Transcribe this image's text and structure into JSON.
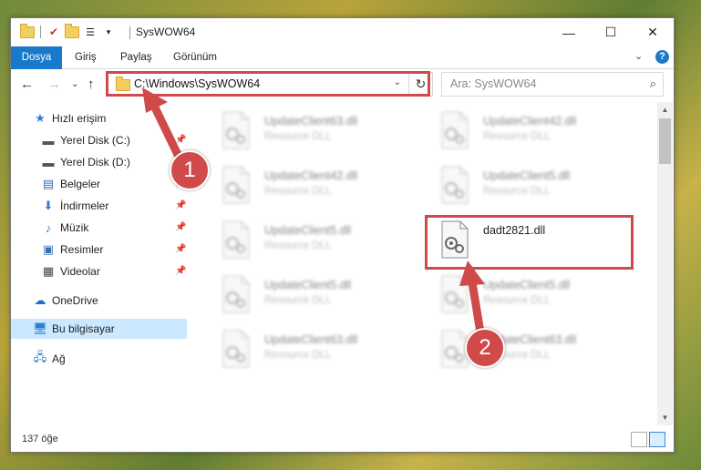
{
  "window": {
    "title": "SysWOW64",
    "controls": {
      "minimize": "—",
      "maximize": "☐",
      "close": "✕"
    }
  },
  "ribbon": {
    "tabs": [
      "Dosya",
      "Giriş",
      "Paylaş",
      "Görünüm"
    ],
    "expand_glyph": "⌄",
    "help": "?"
  },
  "navigation": {
    "back": "←",
    "forward": "→",
    "recent": "⌄",
    "up": "↑",
    "address": "C:\\Windows\\SysWOW64",
    "address_dropdown": "⌄",
    "refresh": "↻",
    "search_placeholder": "Ara: SysWOW64",
    "search_icon": "search-icon"
  },
  "sidebar": {
    "items": [
      {
        "label": "Hızlı erişim",
        "icon": "star-icon",
        "pinned": false
      },
      {
        "label": "Yerel Disk (C:)",
        "icon": "drive-icon",
        "pinned": true
      },
      {
        "label": "Yerel Disk (D:)",
        "icon": "drive-icon",
        "pinned": false
      },
      {
        "label": "Belgeler",
        "icon": "documents-icon",
        "pinned": true
      },
      {
        "label": "İndirmeler",
        "icon": "download-icon",
        "pinned": true
      },
      {
        "label": "Müzik",
        "icon": "music-icon",
        "pinned": true
      },
      {
        "label": "Resimler",
        "icon": "pictures-icon",
        "pinned": true
      },
      {
        "label": "Videolar",
        "icon": "videos-icon",
        "pinned": true
      },
      {
        "label": "OneDrive",
        "icon": "cloud-icon",
        "pinned": false
      },
      {
        "label": "Bu bilgisayar",
        "icon": "computer-icon",
        "pinned": false
      },
      {
        "label": "Ağ",
        "icon": "network-icon",
        "pinned": false
      }
    ]
  },
  "files": [
    {
      "name": "UpdateClient63.dll",
      "type": "Resource DLL"
    },
    {
      "name": "UpdateClient42.dll",
      "type": "Resource DLL"
    },
    {
      "name": "UpdateClient42.dll",
      "type": "Resource DLL"
    },
    {
      "name": "UpdateClient5.dll",
      "type": "Resource DLL"
    },
    {
      "name": "UpdateClient5.dll",
      "type": "Resource DLL"
    },
    {
      "name": "dadt2821.dll",
      "type": ""
    },
    {
      "name": "UpdateClient5.dll",
      "type": "Resource DLL"
    },
    {
      "name": "UpdateClient5.dll",
      "type": "Resource DLL"
    },
    {
      "name": "UpdateClient63.dll",
      "type": "Resource DLL"
    },
    {
      "name": "UpdateClient63.dll",
      "type": "Resource DLL"
    }
  ],
  "status": {
    "item_count": "137 öğe"
  },
  "annotations": {
    "step1": "1",
    "step2": "2",
    "color": "#d14a4a"
  }
}
